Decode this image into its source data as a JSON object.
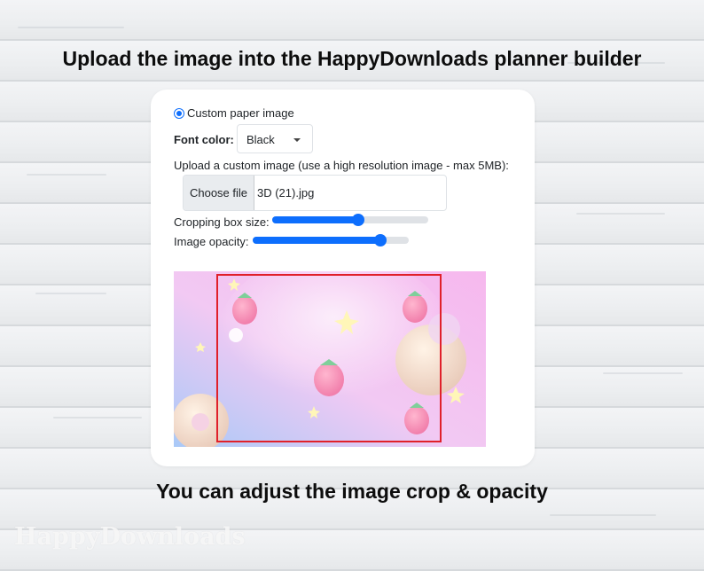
{
  "headings": {
    "top": "Upload the image into the HappyDownloads planner builder",
    "bottom": "You can adjust the image crop & opacity"
  },
  "watermark": "HappyDownloads",
  "form": {
    "radio_label": "Custom paper image",
    "radio_checked": true,
    "font_color_label": "Font color:",
    "font_color_value": "Black",
    "upload_label": "Upload a custom image (use a high resolution image - max 5MB):",
    "choose_file_label": "Choose file",
    "file_name": "3D (21).jpg",
    "crop_size_label": "Cropping box size:",
    "crop_size_value": 0.55,
    "opacity_label": "Image opacity:",
    "opacity_value": 0.82
  },
  "colors": {
    "accent": "#0d6efd",
    "crop_border": "#e0202a"
  }
}
